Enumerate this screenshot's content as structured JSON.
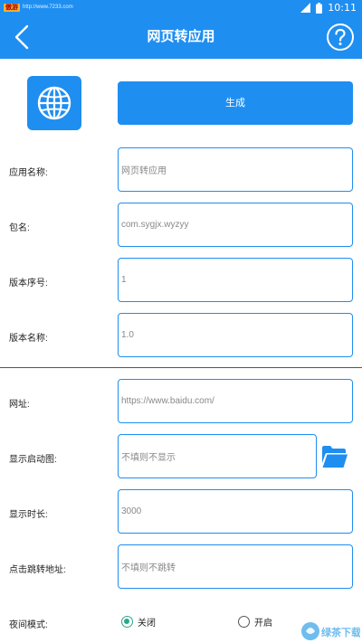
{
  "status_bar": {
    "badge": "傲游",
    "url": "http://www.7233.com",
    "time": "10:11"
  },
  "app_bar": {
    "title": "网页转应用",
    "back_icon": "chevron-left-icon",
    "help_icon": "help-circle-icon"
  },
  "header": {
    "app_icon": "globe-icon",
    "generate_label": "生成"
  },
  "form": {
    "app_name": {
      "label": "应用名称:",
      "value": "网页转应用"
    },
    "package": {
      "label": "包名:",
      "value": "com.sygjx.wyzyy"
    },
    "version_code": {
      "label": "版本序号:",
      "value": "1"
    },
    "version_name": {
      "label": "版本名称:",
      "value": "1.0"
    },
    "url": {
      "label": "网址:",
      "value": "https://www.baidu.com/"
    },
    "splash": {
      "label": "显示启动图:",
      "placeholder": "不填则不显示",
      "folder_icon": "folder-open-icon"
    },
    "duration": {
      "label": "显示时长:",
      "value": "3000"
    },
    "click_url": {
      "label": "点击跳转地址:",
      "placeholder": "不填则不跳转"
    },
    "night_mode": {
      "label": "夜间模式:",
      "options": [
        {
          "label": "关闭",
          "selected": true
        },
        {
          "label": "开启",
          "selected": false
        }
      ]
    }
  },
  "watermark": {
    "text": "绿茶下载"
  },
  "colors": {
    "primary": "#1f8ef1",
    "radio_accent": "#2aa889"
  }
}
